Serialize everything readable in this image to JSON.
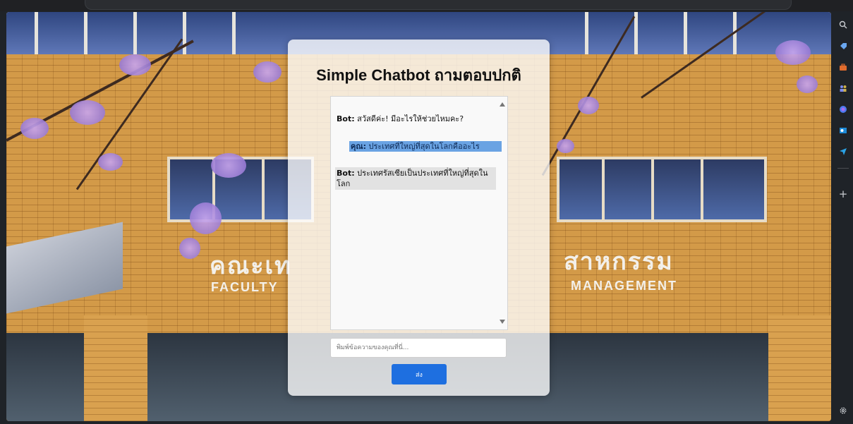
{
  "chat": {
    "title": "Simple Chatbot ถามตอบปกติ",
    "messages": [
      {
        "sender": "Bot:",
        "text": " สวัสดีค่ะ! มีอะไรให้ช่วยไหมคะ?"
      },
      {
        "sender": "คุณ:",
        "text": " ประเทศที่ใหญ่ที่สุดในโลกคืออะไร"
      },
      {
        "sender": "Bot:",
        "text": " ประเทศรัสเซียเป็นประเทศที่ใหญ่ที่สุดในโลก"
      }
    ],
    "input_placeholder": "พิมพ์ข้อความของคุณที่นี่...",
    "send_label": "ส่ง"
  },
  "background": {
    "sign_thai_left": "คณะเท",
    "sign_thai_right": "สาหกรรม",
    "sign_eng_left": "FACULTY",
    "sign_eng_right": "MANAGEMENT"
  },
  "sidebar": {
    "add_label": "+",
    "icons": [
      "search-icon",
      "tag-icon",
      "briefcase-icon",
      "people-icon",
      "copilot-icon",
      "outlook-icon",
      "send-icon",
      "settings-icon"
    ]
  },
  "colors": {
    "send_button": "#1e6fe0",
    "user_highlight": "#6aa3e3",
    "bot_bubble": "#e2e2e2"
  }
}
